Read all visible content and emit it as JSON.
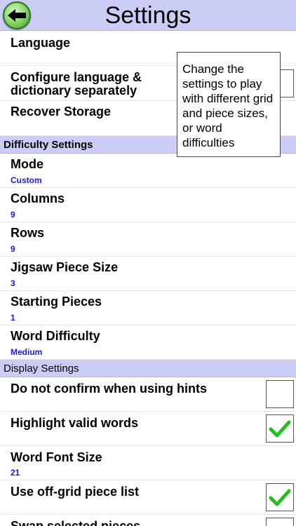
{
  "header": {
    "title": "Settings"
  },
  "general": {
    "language_label": "Language",
    "configure_label": "Configure language & dictionary separately",
    "configure_checked": false,
    "recover_label": "Recover Storage"
  },
  "tooltip": {
    "text": "Change the settings to play with different grid and piece sizes, or word difficulties"
  },
  "difficulty": {
    "section_title": "Difficulty Settings",
    "items": [
      {
        "label": "Mode",
        "value": "Custom"
      },
      {
        "label": "Columns",
        "value": "9"
      },
      {
        "label": "Rows",
        "value": "9"
      },
      {
        "label": "Jigsaw Piece Size",
        "value": "3"
      },
      {
        "label": "Starting Pieces",
        "value": "1"
      },
      {
        "label": "Word Difficulty",
        "value": "Medium"
      }
    ]
  },
  "display": {
    "section_title": "Display Settings",
    "no_confirm_label": "Do not confirm when using hints",
    "no_confirm_checked": false,
    "highlight_label": "Highlight valid words",
    "highlight_checked": true,
    "font_size_label": "Word Font Size",
    "font_size_value": "21",
    "offgrid_label": "Use off-grid piece list",
    "offgrid_checked": true,
    "swap_label": "Swap selected pieces"
  },
  "colors": {
    "accent": "#cccdf7",
    "value_text": "#1a1ad6",
    "check_green": "#22c01a"
  }
}
